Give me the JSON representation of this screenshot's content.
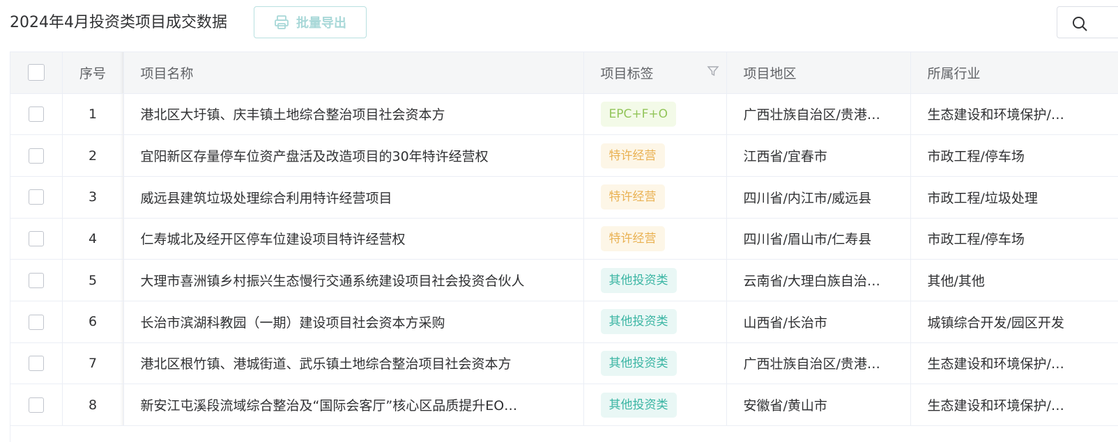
{
  "header": {
    "title": "2024年4月投资类项目成交数据",
    "export_label": "批量导出"
  },
  "table": {
    "columns": {
      "seq": "序号",
      "name": "项目名称",
      "tag": "项目标签",
      "region": "项目地区",
      "industry": "所属行业"
    },
    "rows": [
      {
        "seq": "1",
        "name": "港北区大圩镇、庆丰镇土地综合整治项目社会资本方",
        "tag": "EPC+F+O",
        "tag_type": "epc",
        "region": "广西壮族自治区/贵港…",
        "industry": "生态建设和环境保护/…"
      },
      {
        "seq": "2",
        "name": "宜阳新区存量停车位资产盘活及改造项目的30年特许经营权",
        "tag": "特许经营",
        "tag_type": "tx",
        "region": "江西省/宜春市",
        "industry": "市政工程/停车场"
      },
      {
        "seq": "3",
        "name": "威远县建筑垃圾处理综合利用特许经营项目",
        "tag": "特许经营",
        "tag_type": "tx",
        "region": "四川省/内江市/威远县",
        "industry": "市政工程/垃圾处理"
      },
      {
        "seq": "4",
        "name": "仁寿城北及经开区停车位建设项目特许经营权",
        "tag": "特许经营",
        "tag_type": "tx",
        "region": "四川省/眉山市/仁寿县",
        "industry": "市政工程/停车场"
      },
      {
        "seq": "5",
        "name": "大理市喜洲镇乡村振兴生态慢行交通系统建设项目社会投资合伙人",
        "tag": "其他投资类",
        "tag_type": "qt",
        "region": "云南省/大理白族自治…",
        "industry": "其他/其他"
      },
      {
        "seq": "6",
        "name": "长治市滨湖科教园（一期）建设项目社会资本方采购",
        "tag": "其他投资类",
        "tag_type": "qt",
        "region": "山西省/长治市",
        "industry": "城镇综合开发/园区开发"
      },
      {
        "seq": "7",
        "name": "港北区根竹镇、港城街道、武乐镇土地综合整治项目社会资本方",
        "tag": "其他投资类",
        "tag_type": "qt",
        "region": "广西壮族自治区/贵港…",
        "industry": "生态建设和环境保护/…"
      },
      {
        "seq": "8",
        "name": "新安江屯溪段流域综合整治及“国际会客厅”核心区品质提升EO…",
        "tag": "其他投资类",
        "tag_type": "qt",
        "region": "安徽省/黄山市",
        "industry": "生态建设和环境保护/…"
      }
    ]
  }
}
